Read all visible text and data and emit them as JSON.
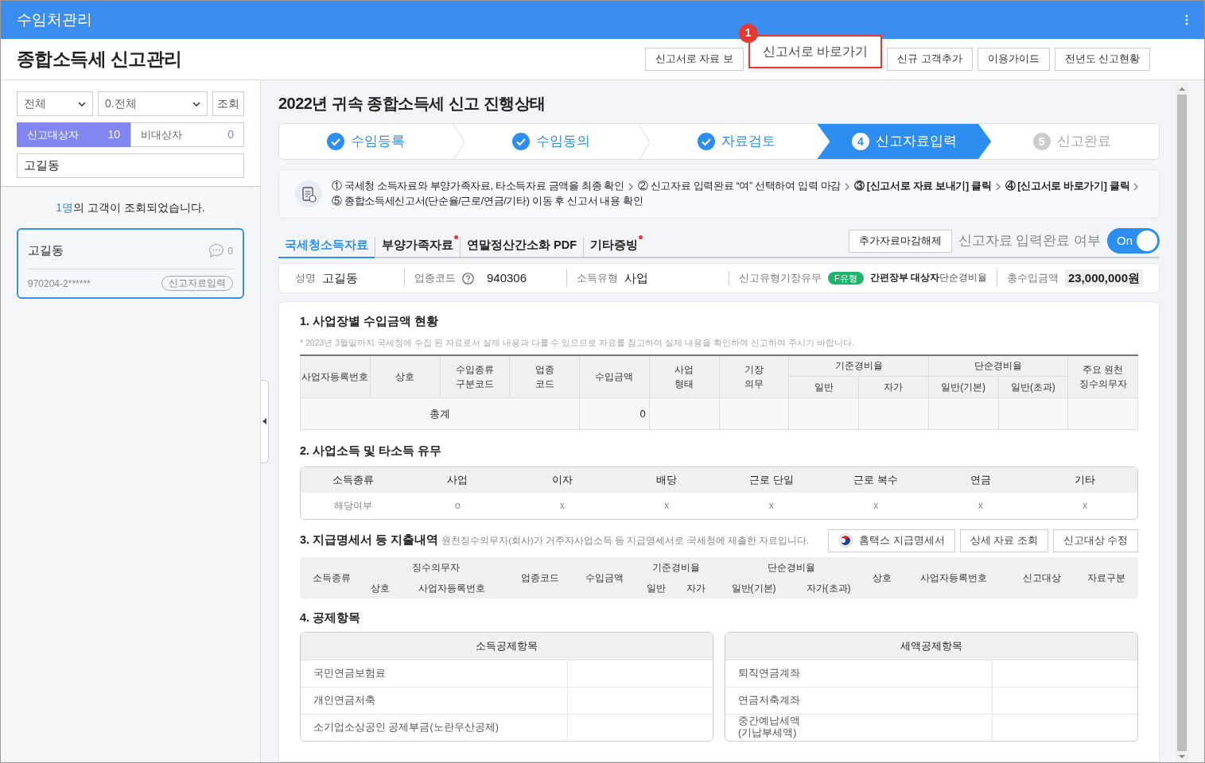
{
  "app_bar": {
    "title": "수임처관리"
  },
  "page_title": "종합소득세 신고관리",
  "top_buttons": [
    {
      "label": "신고서로 자료 보",
      "kind": "plain"
    },
    {
      "label": "신고서로 바로가기",
      "kind": "callout",
      "badge": "1"
    },
    {
      "label": "신규 고객추가",
      "kind": "plain"
    },
    {
      "label": "이용가이드",
      "kind": "plain"
    },
    {
      "label": "전년도 신고현황",
      "kind": "plain"
    }
  ],
  "sidebar": {
    "filters": [
      {
        "value": "전체"
      },
      {
        "value": "0.전체"
      }
    ],
    "query_button": "조회",
    "tabs": [
      {
        "label": "신고대상자",
        "count": "10",
        "selected": true
      },
      {
        "label": "비대상자",
        "count": "0",
        "selected": false
      }
    ],
    "search": {
      "value": "고길동"
    },
    "result_count": "1명",
    "result_text": "의 고객이 조회되었습니다.",
    "clients": [
      {
        "name": "고길동",
        "comments": "0",
        "id": "970204-2******",
        "status": "신고자료입력",
        "selected": true
      }
    ]
  },
  "main": {
    "title": "2022년 귀속 종합소득세 신고 진행상태",
    "steps": [
      {
        "label": "수임등록",
        "done": true,
        "selected": false
      },
      {
        "label": "수임동의",
        "done": true,
        "selected": false
      },
      {
        "label": "자료검토",
        "done": true,
        "selected": false
      },
      {
        "label": "신고자료입력",
        "done": false,
        "selected": true,
        "number": "4"
      },
      {
        "label": "신고완료",
        "done": false,
        "selected": false,
        "number": "5"
      }
    ],
    "guide": [
      {
        "text": "① 국세청 소득자료와 부양가족자료, 타소득자료 금액을 최종 확인",
        "bold": false
      },
      {
        "text": "② 신고자료 입력완료 “여” 선택하여 입력 마감",
        "bold": false
      },
      {
        "text": "③ [신고서로 자료 보내기] 클릭",
        "bold": true
      },
      {
        "text": "④ [신고서로 바로가기] 클릭",
        "bold": true
      },
      {
        "text": "⑤ 종합소득세신고서(단순율/근로/연금/기타) 이동 후 신고서 내용 확인",
        "bold": false
      }
    ],
    "tabs": [
      {
        "label": "국세청소득자료",
        "selected": true,
        "alert": false
      },
      {
        "label": "부양가족자료",
        "selected": false,
        "alert": true
      },
      {
        "label": "연말정산간소화 PDF",
        "selected": false,
        "alert": false
      },
      {
        "label": "기타증빙",
        "selected": false,
        "alert": true
      }
    ],
    "unlock_button": "추가자료마감해제",
    "complete_label": "신고자료 입력완료 여부",
    "complete_toggle": {
      "label": "On",
      "on": true
    },
    "info": [
      {
        "label": "성명",
        "value": "고길동",
        "kind": "plain"
      },
      {
        "label": "업종코드",
        "value": "940306",
        "kind": "help"
      },
      {
        "label": "소득유형",
        "value": "사업",
        "kind": "plain"
      },
      {
        "label": "신고유형기장유무",
        "badge": "F유형",
        "value": "간편장부 대상자",
        "suffix": "단순경비율",
        "kind": "type"
      },
      {
        "label": "총수입금액",
        "value": "23,000,000원",
        "kind": "amount"
      }
    ],
    "section1": {
      "title": "1. 사업장별 수입금액 현황",
      "note": "* 2023년 3월말까지 국세청에 수집 된 자료로서 실제 내용과 다를 수 있으므로 자료를 참고하여 실제 내용을 확인하여 신고하여 주시기 바랍니다.",
      "columns": [
        {
          "label": "사업자등록번호"
        },
        {
          "label": "상호"
        },
        {
          "label": "수입종류\n구분코드"
        },
        {
          "label": "업종\n코드"
        },
        {
          "label": "수입금액"
        },
        {
          "label": "사업\n형태"
        },
        {
          "label": "기장\n의무"
        },
        {
          "label": "기준경비율",
          "children": [
            "일반",
            "자가"
          ]
        },
        {
          "label": "단순경비율",
          "children": [
            "일반(기본)",
            "일반(초과)"
          ]
        },
        {
          "label": "주요 원천\n징수의무자"
        }
      ],
      "total": {
        "label": "총계",
        "amount": "0"
      }
    },
    "section2": {
      "title": "2. 사업소득 및 타소득 유무",
      "columns": [
        "소득종류",
        "사업",
        "이자",
        "배당",
        "근로 단일",
        "근로 복수",
        "연금",
        "기타"
      ],
      "row": [
        "해당여부",
        "o",
        "x",
        "x",
        "x",
        "x",
        "x",
        "x"
      ]
    },
    "section3": {
      "title": "3. 지급명세서 등 지출내역",
      "note": "원천징수의무자(회사)가 거주자사업소득 등 지급명세서로 국세청에 제출한 자료입니다.",
      "buttons": [
        {
          "label": "홈택스 지급명세서",
          "kind": "emblem"
        },
        {
          "label": "상세 자료 조회",
          "kind": "plain"
        },
        {
          "label": "신고대상 수정",
          "kind": "plain"
        }
      ],
      "columns": [
        {
          "label": "소득종류"
        },
        {
          "label": "징수의무자",
          "children": [
            "상호",
            "사업자등록번호"
          ]
        },
        {
          "label": "업종코드"
        },
        {
          "label": "수입금액"
        },
        {
          "label": "기준경비율",
          "children": [
            "일반",
            "자가"
          ]
        },
        {
          "label": "단순경비율",
          "children": [
            "일반(기본)",
            "자가(초과)"
          ]
        },
        {
          "label": "상호"
        },
        {
          "label": "사업자등록번호"
        },
        {
          "label": "신고대상"
        },
        {
          "label": "자료구분"
        }
      ]
    },
    "section4": {
      "title": "4. 공제항목",
      "tables": [
        {
          "heading": "소득공제항목",
          "rows": [
            "국민연금보험료",
            "개인연금저축",
            "소기업소상공인 공제부금(노란우산공제)"
          ]
        },
        {
          "heading": "세액공제항목",
          "rows": [
            "퇴직연금계좌",
            "연금저축계좌",
            "중간예납세액\n(기납부세액)"
          ]
        }
      ]
    }
  }
}
